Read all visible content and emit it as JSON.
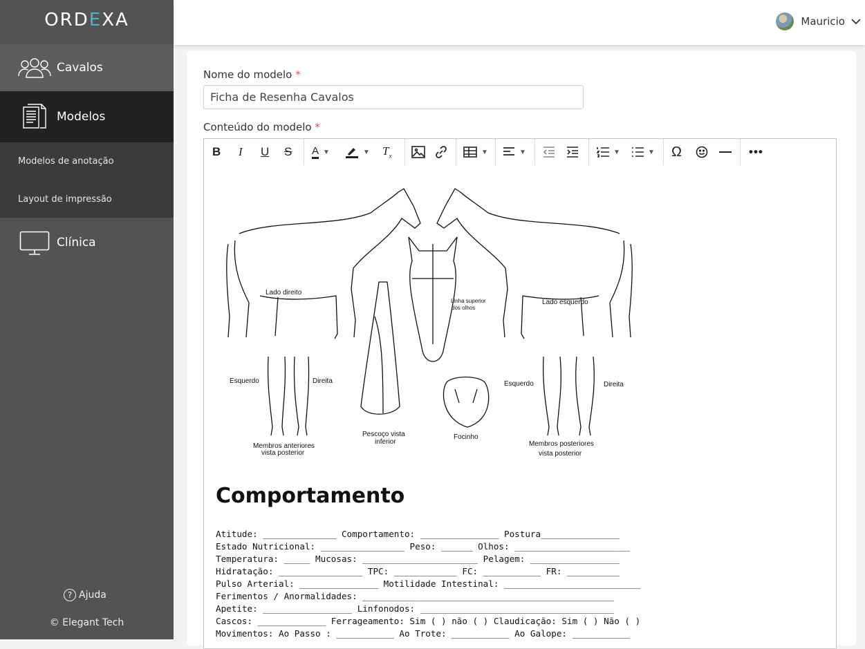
{
  "app": {
    "logo_left": "ORD",
    "logo_e": "E",
    "logo_right": "XA"
  },
  "sidebar": {
    "items": [
      {
        "label": "Cavalos",
        "icon": "users-icon"
      },
      {
        "label": "Modelos",
        "icon": "documents-icon"
      },
      {
        "label": "Clínica",
        "icon": "monitor-icon"
      }
    ],
    "subitems": [
      {
        "label": "Modelos de anotação"
      },
      {
        "label": "Layout de impressão"
      }
    ],
    "help": "Ajuda",
    "copyright": "© Elegant Tech"
  },
  "header": {
    "user_name": "Mauricio"
  },
  "form": {
    "name_label": "Nome do modelo",
    "name_required": "*",
    "name_value": "Ficha de Resenha Cavalos",
    "content_label": "Conteúdo do modelo",
    "content_required": "*"
  },
  "toolbar": {
    "buttons": [
      "bold",
      "italic",
      "underline",
      "strikethrough",
      "font-color",
      "highlight",
      "clear-format",
      "image",
      "link",
      "table",
      "align",
      "outdent",
      "indent",
      "numbered-list",
      "bulleted-list",
      "special-char",
      "emoji",
      "horizontal-line",
      "more"
    ]
  },
  "figure": {
    "labels": {
      "lado_direito": "Lado direito",
      "lado_esquerdo": "Lado esquerdo",
      "linha_superior_1": "Linha superior",
      "linha_superior_2": "dos olhos",
      "esquerdo_1": "Esquerdo",
      "direita_1": "Direita",
      "esquerdo_2": "Esquerdo",
      "direita_2": "Direita",
      "membros_ant_1": "Membros anteriores",
      "membros_ant_2": "vista posterior",
      "pescoco_1": "Pescoço vista",
      "pescoco_2": "inferior",
      "focinho": "Focinho",
      "membros_post_1": "Membros posteriores",
      "membros_post_2": "vista posterior"
    }
  },
  "content": {
    "heading": "Comportamento",
    "lines": [
      "Atitude: ______________ Comportamento: _______________ Postura_______________",
      "Estado Nutricional: ________________ Peso: ______ Olhos: ______________________",
      "Temperatura: _____ Mucosas: ______________________ Pelagem: _________________",
      "Hidratação: ________________ TPC: ____________ FC: ___________ FR: __________",
      "Pulso Arterial: _______________ Motilidade Intestinal: __________________________",
      "Ferimentos / Anormalidades: ________________________________________________",
      "Apetite: _________________ Linfonodos: _____________________________________",
      "Cascos: _____________ Ferrageamento: Sim ( ) não ( ) Claudicação: Sim ( ) Não ( )",
      "Movimentos: Ao Passo : ___________ Ao Trote: ___________ Ao Galope: ___________"
    ]
  }
}
